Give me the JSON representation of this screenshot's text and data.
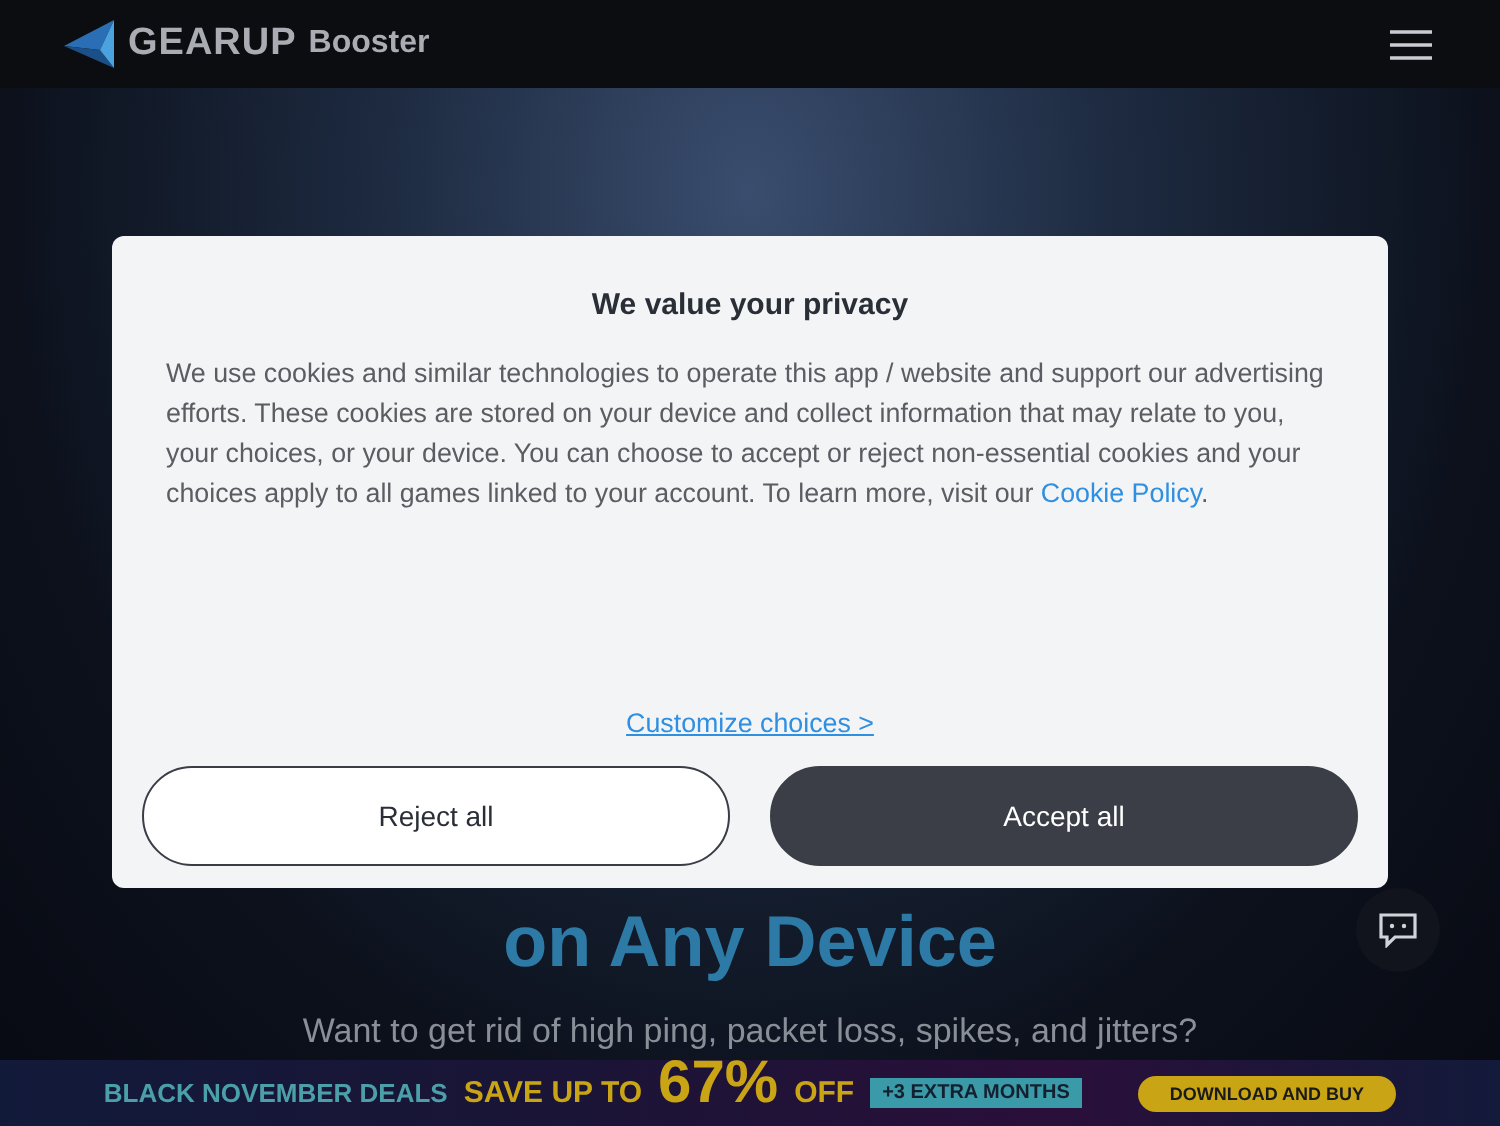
{
  "header": {
    "brand": "GEARUP",
    "product": "Booster"
  },
  "hero": {
    "headline": "on Any Device",
    "subtitle": "Want to get rid of high ping, packet loss, spikes, and jitters?"
  },
  "banner": {
    "title": "BLACK NOVEMBER DEALS",
    "save": "SAVE UP TO",
    "percent": "67%",
    "off": "OFF",
    "tag": "+3 EXTRA MONTHS",
    "button": "DOWNLOAD AND BUY"
  },
  "consent": {
    "title": "We value your privacy",
    "text": "We use cookies and similar technologies to operate this app / website and support our advertising efforts. These cookies are stored on your device and collect information that may relate to you, your choices, or your device. You can choose to accept or reject non-essential cookies and your choices apply to all games linked to your account. To learn more, visit our ",
    "link": "Cookie Policy",
    "text_end": ".",
    "customize": "Customize choices >",
    "buttons": [
      {
        "label": "Reject all",
        "kind": "secondary"
      },
      {
        "label": "Accept all",
        "kind": "primary"
      }
    ]
  }
}
